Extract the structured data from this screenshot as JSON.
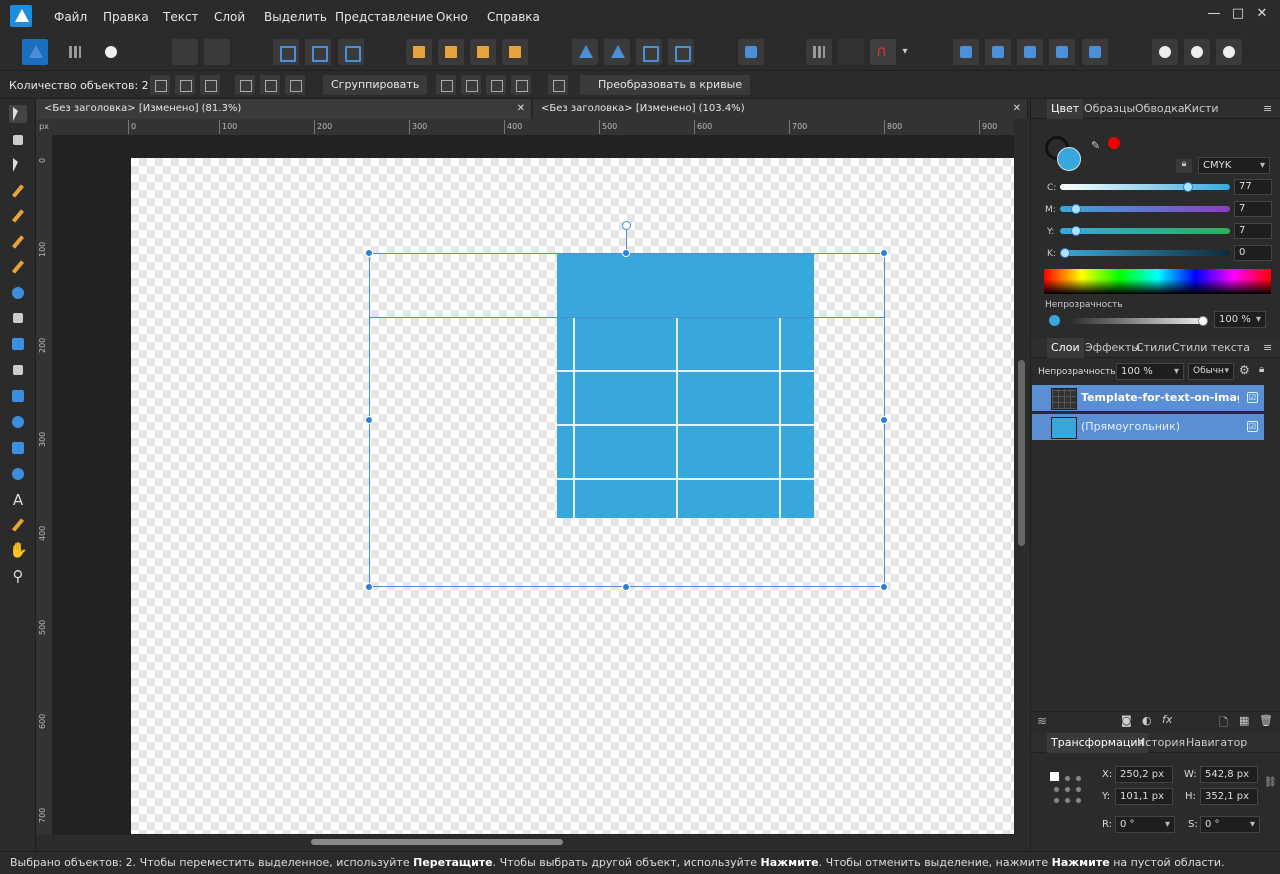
{
  "menu": [
    "Файл",
    "Правка",
    "Текст",
    "Слой",
    "Выделить",
    "Представление",
    "Окно",
    "Справка"
  ],
  "context": {
    "count_label": "Количество объектов: 2",
    "group_button": "Сгруппировать",
    "convert_button": "Преобразовать в кривые"
  },
  "tabs": [
    {
      "title": "<Без заголовка> [Изменено] (81.3%)"
    },
    {
      "title": "<Без заголовка> [Изменено] (103.4%)"
    }
  ],
  "ruler": {
    "unit": "px",
    "h_ticks": [
      "0",
      "100",
      "200",
      "300",
      "400",
      "500",
      "600",
      "700",
      "800",
      "900"
    ],
    "v_ticks": [
      "0",
      "100",
      "200",
      "300",
      "400",
      "500",
      "600",
      "700"
    ]
  },
  "color_panel": {
    "tabs": [
      "Цвет",
      "Образцы",
      "Обводка",
      "Кисти"
    ],
    "mode": "CMYK",
    "sliders": [
      {
        "label": "C:",
        "value": "77",
        "fraction": 0.77,
        "color": "#38a8dc"
      },
      {
        "label": "M:",
        "value": "7",
        "fraction": 0.07,
        "color": "#8a3fc4"
      },
      {
        "label": "Y:",
        "value": "7",
        "fraction": 0.07,
        "color": "#2fae5a"
      },
      {
        "label": "K:",
        "value": "0",
        "fraction": 0.0,
        "color": "#0d2a3a"
      }
    ],
    "opacity_label": "Непрозрачность",
    "opacity_value": "100 %"
  },
  "layers_panel": {
    "tabs": [
      "Слои",
      "Эффекты",
      "Стили",
      "Стили текста"
    ],
    "opacity_label": "Непрозрачность:",
    "opacity_value": "100 %",
    "blend_mode": "Обычн",
    "layers": [
      {
        "name": "Template-for-text-on-image...",
        "checked": "☑"
      },
      {
        "name": "(Прямоугольник)",
        "checked": "☑"
      }
    ]
  },
  "transform_panel": {
    "tabs": [
      "Трансформация",
      "История",
      "Навигатор"
    ],
    "x_label": "X:",
    "x": "250,2 px",
    "y_label": "Y:",
    "y": "101,1 px",
    "w_label": "W:",
    "w": "542,8 px",
    "h_label": "H:",
    "h": "352,1 px",
    "r_label": "R:",
    "r": "0 °",
    "s_label": "S:",
    "s": "0 °"
  },
  "status": {
    "p1": "Выбрано объектов: 2. Чтобы переместить выделенное, используйте ",
    "b1": "Перетащите",
    "p2": ". Чтобы выбрать другой объект, используйте ",
    "b2": "Нажмите",
    "p3": ". Чтобы отменить выделение, нажмите ",
    "b3": "Нажмите",
    "p4": " на пустой области."
  },
  "colors": {
    "accent": "#4b8fd6",
    "rect_fill": "#38a8dc",
    "layer_selected": "#5b8fd3"
  }
}
